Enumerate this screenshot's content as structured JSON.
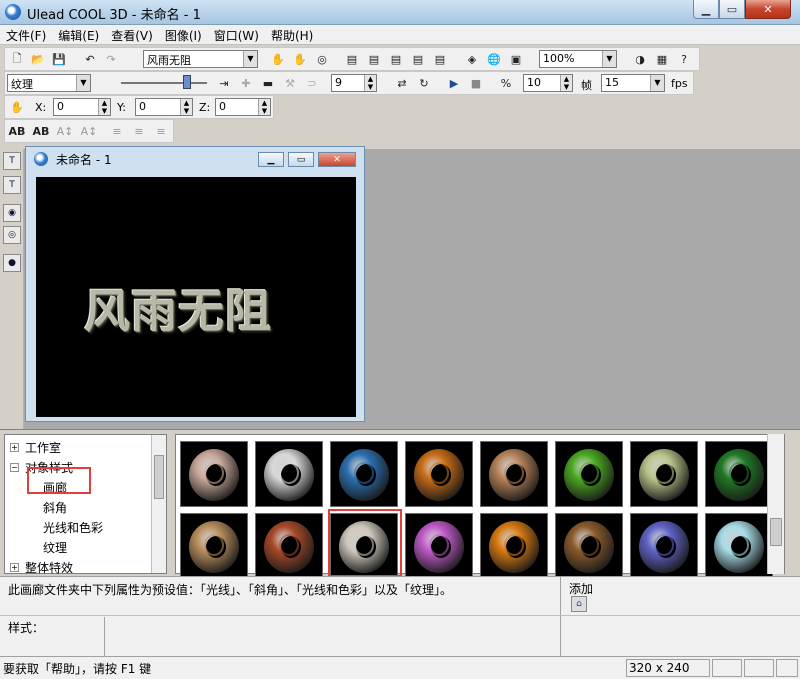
{
  "window": {
    "title": "Ulead COOL 3D - 未命名 - 1"
  },
  "menu": [
    "文件(F)",
    "编辑(E)",
    "查看(V)",
    "图像(I)",
    "窗口(W)",
    "帮助(H)"
  ],
  "toolbar1": {
    "text_value": "风雨无阻",
    "zoom": "100%"
  },
  "toolbar2": {
    "attribute": "纹理",
    "frame_value": "9",
    "fps_frames": "10",
    "frame_label": "帧",
    "fps_value": "15",
    "fps_label": "fps"
  },
  "toolbar3": {
    "x_label": "X:",
    "x_value": "0",
    "y_label": "Y:",
    "y_value": "0",
    "z_label": "Z:",
    "z_value": "0"
  },
  "document": {
    "title": "未命名 - 1",
    "canvas_text": "风雨无阻"
  },
  "tree": {
    "items": [
      {
        "label": "工作室",
        "exp": "+"
      },
      {
        "label": "对象样式",
        "exp": "−"
      },
      {
        "label": "画廊"
      },
      {
        "label": "斜角"
      },
      {
        "label": "光线和色彩"
      },
      {
        "label": "纹理"
      },
      {
        "label": "整体特效",
        "exp": "+"
      }
    ]
  },
  "gallery": {
    "thumbnails": [
      {
        "icon": "donut-pink-marble",
        "color": "#c9a89a"
      },
      {
        "icon": "donut-white-metal",
        "color": "#d8d8d8"
      },
      {
        "icon": "donut-blue-marble",
        "color": "#2a6fb0"
      },
      {
        "icon": "donut-orange-wood",
        "color": "#c96b15"
      },
      {
        "icon": "donut-woven",
        "color": "#b8835a"
      },
      {
        "icon": "donut-rainbow",
        "color": "#4aa820"
      },
      {
        "icon": "donut-green-stone",
        "color": "#b8c48a"
      },
      {
        "icon": "donut-green-marble",
        "color": "#1f7a25"
      },
      {
        "icon": "donut-tan-stone",
        "color": "#b98e5e"
      },
      {
        "icon": "donut-red-speckle",
        "color": "#a84828"
      },
      {
        "icon": "donut-gray-marble",
        "color": "#cfc8bc"
      },
      {
        "icon": "donut-iridescent",
        "color": "#c05ac8"
      },
      {
        "icon": "donut-amber",
        "color": "#d87a10"
      },
      {
        "icon": "donut-brown-cork",
        "color": "#8a5a2a"
      },
      {
        "icon": "donut-blue-fabric",
        "color": "#5f63c8"
      },
      {
        "icon": "donut-light-cyan",
        "color": "#a8dce8"
      }
    ]
  },
  "description": {
    "text": "此画廊文件夹中下列属性为预设值：「光线」、「斜角」、「光线和色彩」以及「纹理」。",
    "add_label": "添加",
    "style_label": "样式："
  },
  "status": {
    "help_text": "要获取「帮助」，请按 F1 键",
    "size": "320 x 240"
  }
}
